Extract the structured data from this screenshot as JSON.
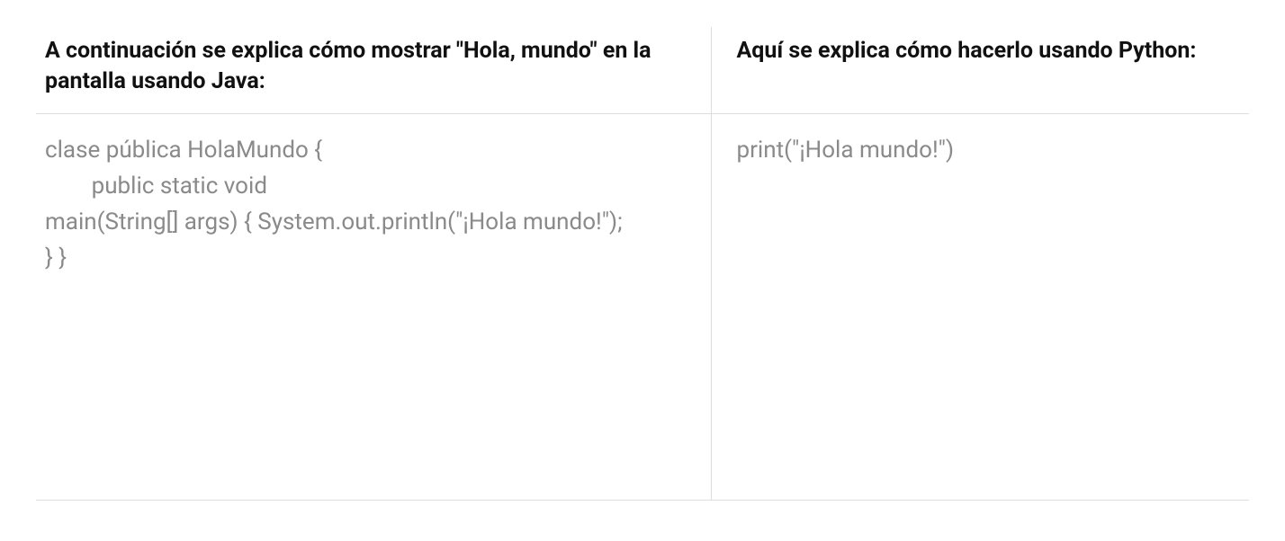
{
  "table": {
    "headers": {
      "java": "A continuación se explica cómo mostrar \"Hola, mundo\" en la pantalla usando Java:",
      "python": "Aquí se explica cómo hacerlo usando Python:"
    },
    "code": {
      "java": "clase pública HolaMundo {\n        public static void\nmain(String[] args) { System.out.println(\"¡Hola mundo!\");\n} }",
      "python": "print(\"¡Hola mundo!\")"
    }
  }
}
